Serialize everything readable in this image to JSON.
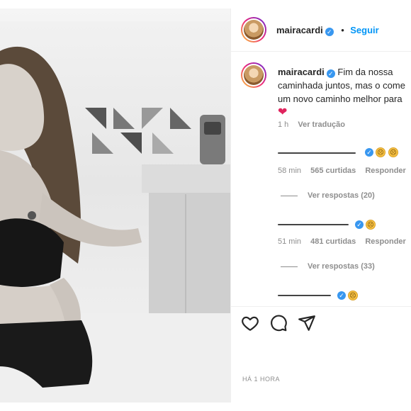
{
  "post": {
    "username": "mairacardi",
    "follow_label": "Seguir",
    "dot": "•",
    "caption_line1": "Fim da nossa",
    "caption_line2": "caminhada juntos, mas o come",
    "caption_line3": "um novo caminho melhor para",
    "caption_heart": "❤",
    "caption_age": "1 h",
    "translate_label": "Ver tradução",
    "posted_label": "HÁ 1 HORA"
  },
  "comments": [
    {
      "age": "58 min",
      "likes": "565 curtidas",
      "reply": "Responder",
      "view_replies": "Ver respostas (20)"
    },
    {
      "age": "51 min",
      "likes": "481 curtidas",
      "reply": "Responder",
      "view_replies": "Ver respostas (33)"
    },
    {
      "age": "",
      "likes": "",
      "reply": "",
      "view_replies": ""
    }
  ],
  "icons": {
    "like": "heart-outline-icon",
    "comment": "comment-bubble-icon",
    "share": "paper-plane-icon",
    "verified": "verified-badge-icon"
  },
  "colors": {
    "accent": "#0095f6",
    "verified": "#3897f0",
    "heart": "#e0245e",
    "muted": "#8e8e8e"
  }
}
